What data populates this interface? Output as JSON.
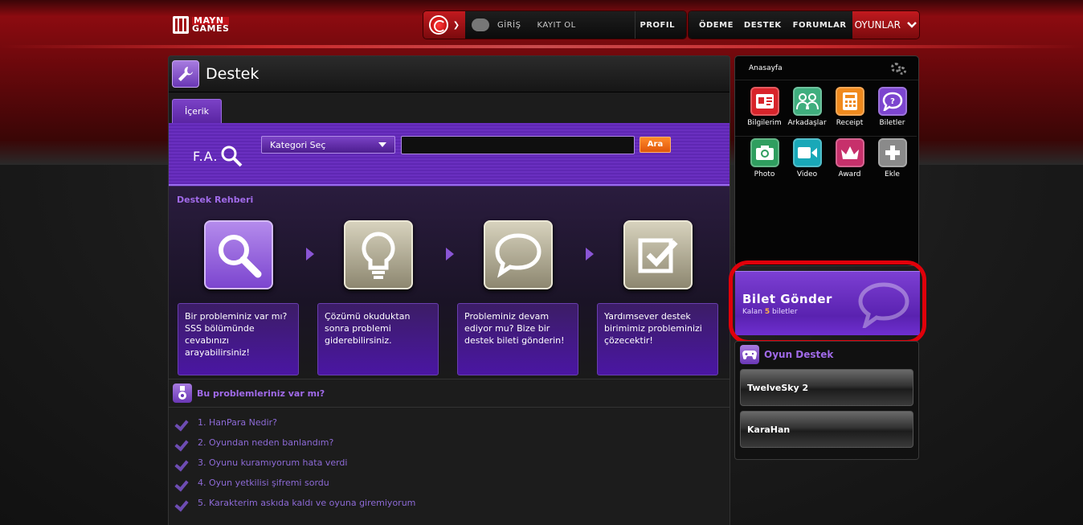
{
  "header": {
    "logo_line1": "MAYN",
    "logo_line2": "GAMES",
    "giris": "GİRİŞ",
    "kayit": "KAYIT OL",
    "profil": "PROFIL",
    "odeme": "ÖDEME",
    "destek": "DESTEK",
    "forumlar": "FORUMLAR",
    "oyunlar": "OYUNLAR"
  },
  "main": {
    "title": "Destek",
    "tab": "İçerik",
    "faq_label": "F.A.",
    "category_select": "Kategori Seç",
    "search_value": "",
    "search_button": "Ara",
    "guide_title": "Destek Rehberi",
    "steps": [
      {
        "text": "Bir probleminiz var mı? SSS bölümünde cevabınızı arayabilirsiniz!"
      },
      {
        "text": "Çözümü okuduktan sonra problemi giderebilirsiniz."
      },
      {
        "text": "Probleminiz devam ediyor mu? Bize bir destek bileti gönderin!"
      },
      {
        "text": "Yardımsever destek birimimiz probleminizi çözecektir!"
      }
    ],
    "problems_title": "Bu problemleriniz var mı?",
    "faq_items": [
      "1. HanPara Nedir?",
      "2. Oyundan neden banlandım?",
      "3. Oyunu kuramıyorum hata verdi",
      "4. Oyun yetkilisi şifremi sordu",
      "5. Karakterim askıda kaldı ve oyuna giremiyorum"
    ]
  },
  "sidebar": {
    "home": "Anasayfa",
    "apps": [
      {
        "label": "Bilgilerim",
        "icon": "id-card-icon",
        "color": "#d8232a"
      },
      {
        "label": "Arkadaşlar",
        "icon": "friends-icon",
        "color": "#3fae7e"
      },
      {
        "label": "Receipt",
        "icon": "calculator-icon",
        "color": "#f08a1e"
      },
      {
        "label": "Biletler",
        "icon": "ticket-chat-icon",
        "color": "#7c45cf"
      },
      {
        "label": "Photo",
        "icon": "camera-icon",
        "color": "#2f9e5f"
      },
      {
        "label": "Video",
        "icon": "video-camera-icon",
        "color": "#19a8b8"
      },
      {
        "label": "Award",
        "icon": "crown-icon",
        "color": "#c7306b"
      },
      {
        "label": "Ekle",
        "icon": "plus-icon",
        "color": "#8a8a8a"
      }
    ],
    "ticket_title": "Bilet Gönder",
    "ticket_prefix": "Kalan",
    "ticket_count": "5",
    "ticket_suffix": "biletler",
    "games_title": "Oyun Destek",
    "games": [
      "TwelveSky 2",
      "KaraHan"
    ]
  }
}
